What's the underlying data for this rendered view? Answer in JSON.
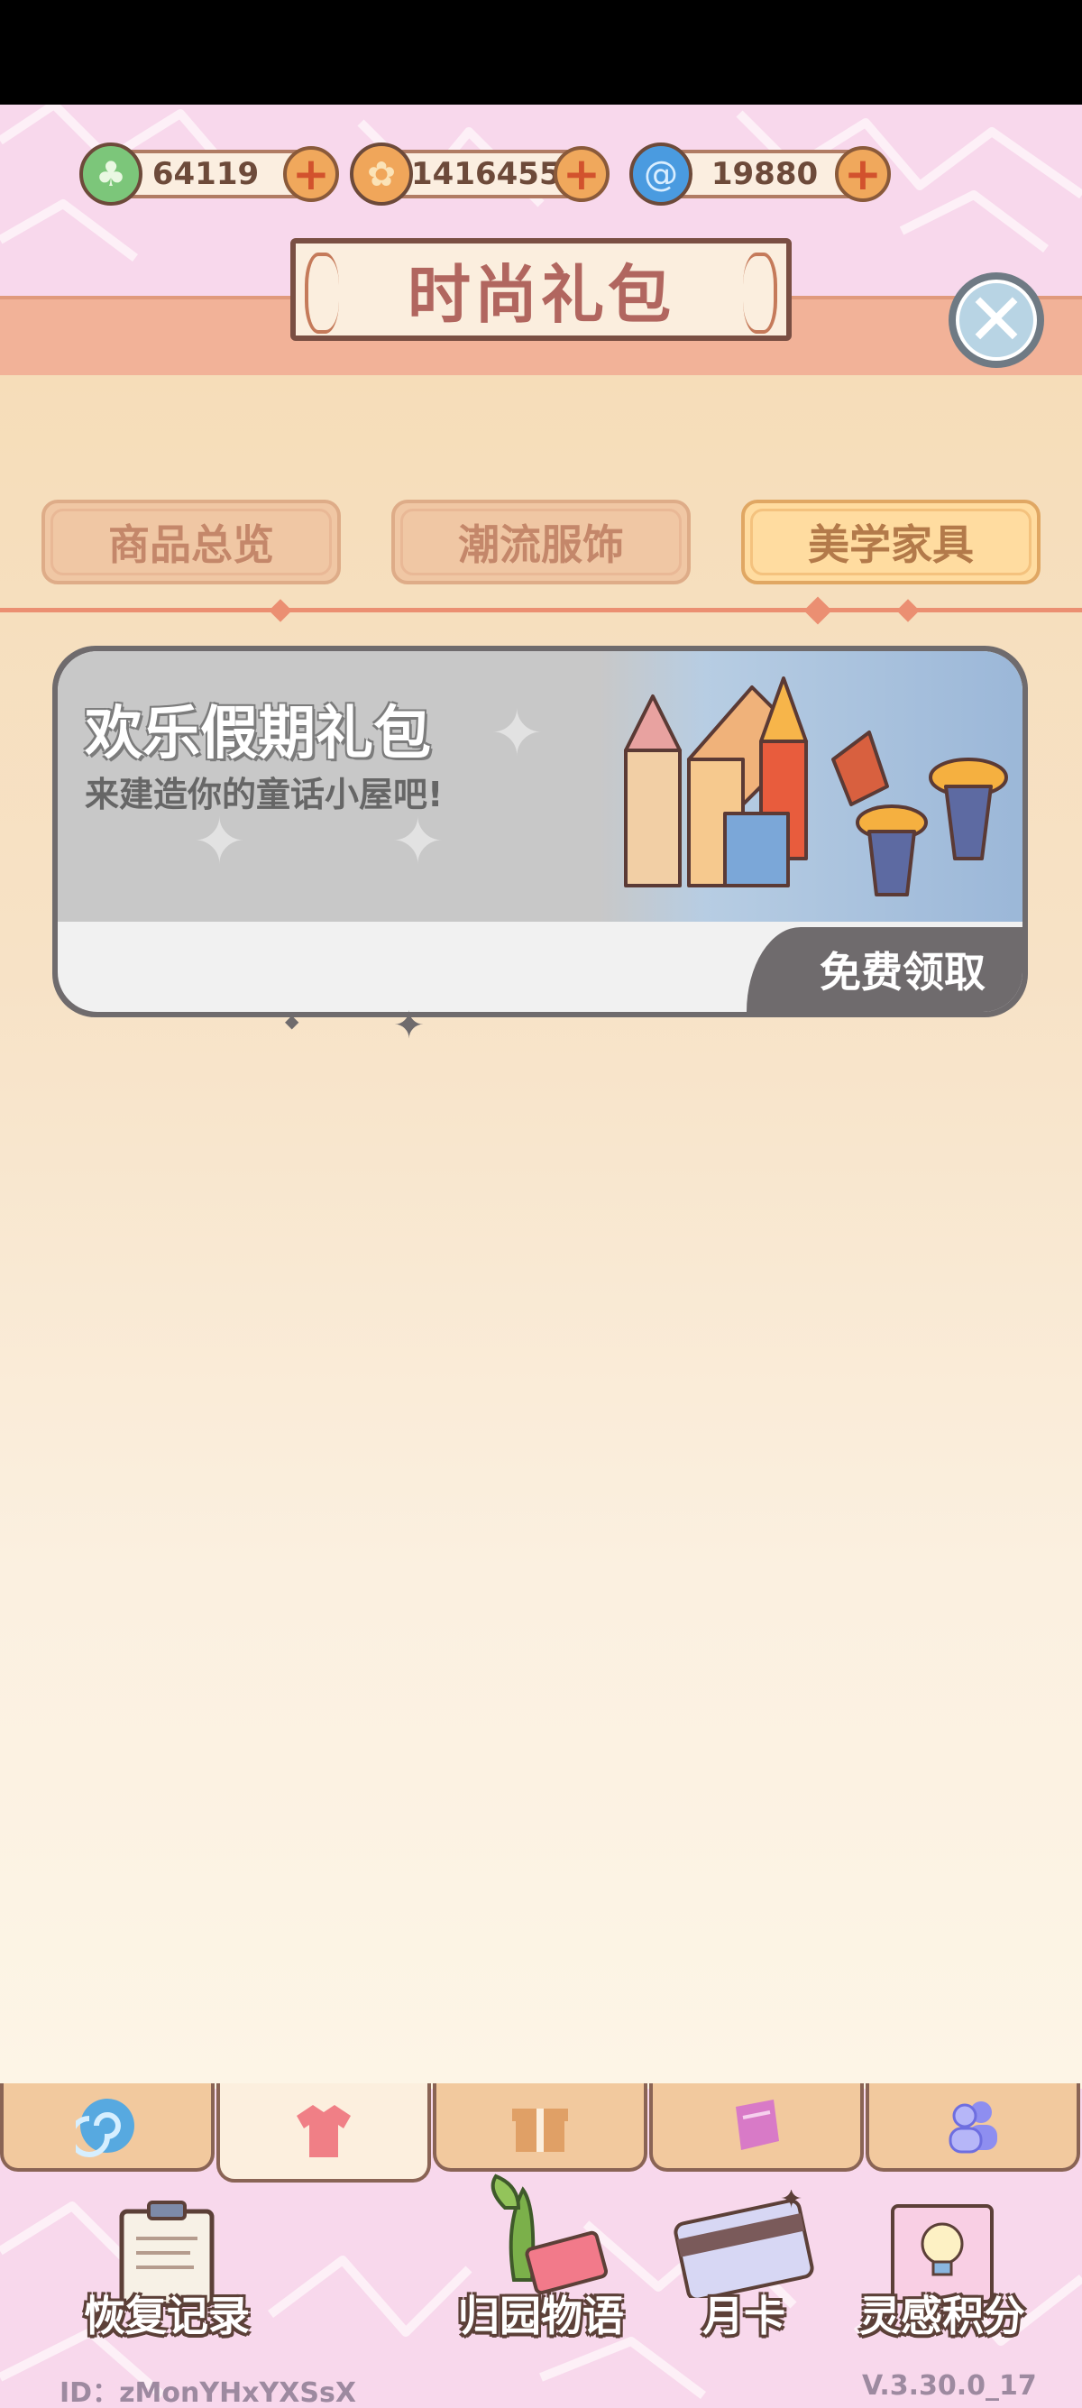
{
  "currencies": [
    {
      "amount": "64119",
      "icon": "leaf-coin-icon",
      "color": "#7cc67a"
    },
    {
      "amount": "1416455",
      "icon": "gold-coin-icon",
      "color": "#f0a65a"
    },
    {
      "amount": "19880",
      "icon": "swirl-gem-icon",
      "color": "#4a9be0"
    }
  ],
  "header": {
    "title": "时尚礼包"
  },
  "tabs": [
    {
      "label": "商品总览",
      "active": false
    },
    {
      "label": "潮流服饰",
      "active": false
    },
    {
      "label": "美学家具",
      "active": true
    }
  ],
  "gift_card": {
    "title": "欢乐假期礼包",
    "subtitle": "来建造你的童话小屋吧!",
    "claim_label": "免费领取"
  },
  "bottom_tabs": [
    {
      "icon": "swirl-icon",
      "active": false
    },
    {
      "icon": "shirt-icon",
      "active": true
    },
    {
      "icon": "gift-icon",
      "active": false
    },
    {
      "icon": "scroll-icon",
      "active": false
    },
    {
      "icon": "friends-icon",
      "active": false
    }
  ],
  "menu": [
    {
      "label": "恢复记录",
      "icon": "clipboard-icon"
    },
    {
      "label": "归园物语",
      "icon": "ticket-plant-icon"
    },
    {
      "label": "月卡",
      "icon": "card-icon"
    },
    {
      "label": "灵感积分",
      "icon": "lightbulb-card-icon"
    }
  ],
  "footer": {
    "user_id": "ID：zMonYHxYXSsX",
    "version": "V.3.30.0_17"
  },
  "colors": {
    "background_pink": "#f8d8ec",
    "panel": "#f6ddb9",
    "accent_coral": "#eb8f72",
    "title_text": "#b1665f"
  }
}
